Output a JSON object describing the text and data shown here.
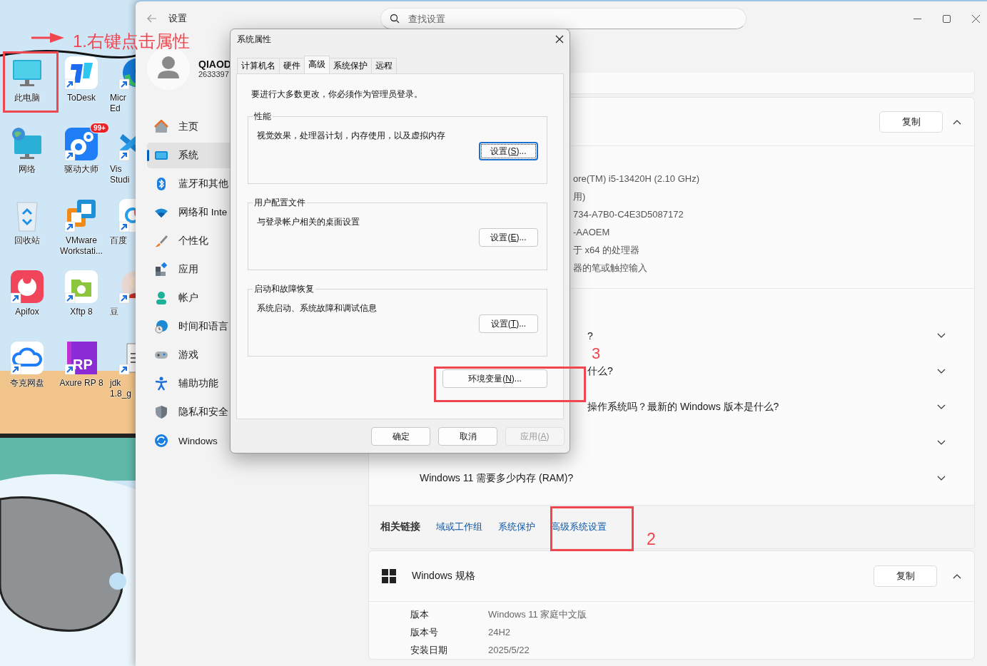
{
  "desktop": {
    "icon_rows": [
      [
        {
          "kind": "monitor",
          "label": [
            "此电脑"
          ],
          "shortcut": false
        },
        {
          "kind": "todesk",
          "label": [
            "ToDesk"
          ],
          "shortcut": true
        },
        {
          "kind": "edge",
          "label": [
            "Micr",
            "Ed"
          ],
          "shortcut": true
        }
      ],
      [
        {
          "kind": "network",
          "label": [
            "网络"
          ],
          "shortcut": false
        },
        {
          "kind": "driver",
          "label": [
            "驱动大师"
          ],
          "shortcut": true,
          "badge": "99+"
        },
        {
          "kind": "vscode",
          "label": [
            "Vis",
            "Studi"
          ],
          "shortcut": true
        }
      ],
      [
        {
          "kind": "recycle",
          "label": [
            "回收站"
          ],
          "shortcut": false
        },
        {
          "kind": "vmware",
          "label": [
            "VMware",
            "Workstati..."
          ],
          "shortcut": true
        },
        {
          "kind": "netdisk",
          "label": [
            "百度"
          ],
          "shortcut": true
        }
      ],
      [
        {
          "kind": "apifox",
          "label": [
            "Apifox"
          ],
          "shortcut": true
        },
        {
          "kind": "xftp",
          "label": [
            "Xftp 8"
          ],
          "shortcut": true
        },
        {
          "kind": "avatar",
          "label": [
            "豆"
          ],
          "shortcut": true
        }
      ],
      [
        {
          "kind": "cloud",
          "label": [
            "夸克网盘"
          ],
          "shortcut": true
        },
        {
          "kind": "axure",
          "label": [
            "Axure RP 8"
          ],
          "shortcut": true,
          "logo_text": "RP"
        },
        {
          "kind": "document",
          "label": [
            "jdk",
            "1.8_g"
          ],
          "shortcut": true
        }
      ]
    ]
  },
  "settings": {
    "title": "设置",
    "search_placeholder": "查找设置",
    "user": {
      "name": "QIAOD",
      "email": "2633397"
    },
    "nav": [
      {
        "kind": "home",
        "label": "主页",
        "selected": false
      },
      {
        "kind": "system",
        "label": "系统",
        "selected": true
      },
      {
        "kind": "bluetooth",
        "label": "蓝牙和其他",
        "selected": false
      },
      {
        "kind": "wifi",
        "label": "网络和 Inte",
        "selected": false
      },
      {
        "kind": "brush",
        "label": "个性化",
        "selected": false
      },
      {
        "kind": "apps",
        "label": "应用",
        "selected": false
      },
      {
        "kind": "account",
        "label": "帐户",
        "selected": false
      },
      {
        "kind": "time",
        "label": "时间和语言",
        "selected": false
      },
      {
        "kind": "gaming",
        "label": "游戏",
        "selected": false
      },
      {
        "kind": "accessibility",
        "label": "辅助功能",
        "selected": false
      },
      {
        "kind": "privacy",
        "label": "隐私和安全",
        "selected": false
      },
      {
        "kind": "update",
        "label": "Windows",
        "selected": false
      }
    ],
    "device_card": {
      "copy": "复制",
      "expanded": true,
      "specs": [
        "ore(TM) i5-13420H (2.10 GHz)",
        "用)",
        "734-A7B0-C4E3D5087172",
        "-AAOEM",
        "于 x64 的处理器",
        "器的笔或触控输入"
      ]
    },
    "faq": [
      {
        "text": "?",
        "expanded": false
      },
      {
        "text": "什么?",
        "expanded": false
      },
      {
        "text": "操作系统吗？最新的 Windows 版本是什么?",
        "expanded": false
      },
      {
        "expanded": false
      },
      {
        "text": "Windows 11 需要多少内存 (RAM)?",
        "expanded": false
      }
    ],
    "related": {
      "title": "相关链接",
      "links": [
        "域或工作组",
        "系统保护",
        "高级系统设置"
      ]
    },
    "windows_spec": {
      "title": "Windows 规格",
      "copy": "复制",
      "expanded": true,
      "rows": [
        {
          "label": "版本",
          "value": "Windows 11 家庭中文版"
        },
        {
          "label": "版本号",
          "value": "24H2"
        },
        {
          "label": "安装日期",
          "value": "2025/5/22"
        }
      ]
    }
  },
  "dialog": {
    "title": "系统属性",
    "tabs": [
      {
        "label": "计算机名",
        "selected": false
      },
      {
        "label": "硬件",
        "selected": false
      },
      {
        "label": "高级",
        "selected": true
      },
      {
        "label": "系统保护",
        "selected": false
      },
      {
        "label": "远程",
        "selected": false
      }
    ],
    "notice": "要进行大多数更改，你必须作为管理员登录。",
    "groups": [
      {
        "title": "性能",
        "text": "视觉效果，处理器计划，内存使用，以及虚拟内存",
        "button": {
          "before": "设置(",
          "key": "S",
          "after": ")...",
          "focused": true
        }
      },
      {
        "title": "用户配置文件",
        "text": "与登录帐户相关的桌面设置",
        "button": {
          "before": "设置(",
          "key": "E",
          "after": ")...",
          "focused": false
        }
      },
      {
        "title": "启动和故障恢复",
        "text": "系统启动、系统故障和调试信息",
        "button": {
          "before": "设置(",
          "key": "T",
          "after": ")...",
          "focused": false
        }
      }
    ],
    "env_button": {
      "before": "环境变量(",
      "key": "N",
      "after": ")...",
      "focused": false
    },
    "buttons": [
      {
        "before": "确定",
        "disabled": false
      },
      {
        "before": "取消",
        "disabled": false
      },
      {
        "before": "应用(",
        "key": "A",
        "after": ")",
        "disabled": true
      }
    ]
  },
  "annotations": {
    "step1": "1.右键点击属性",
    "step2": "2",
    "step3": "3"
  }
}
